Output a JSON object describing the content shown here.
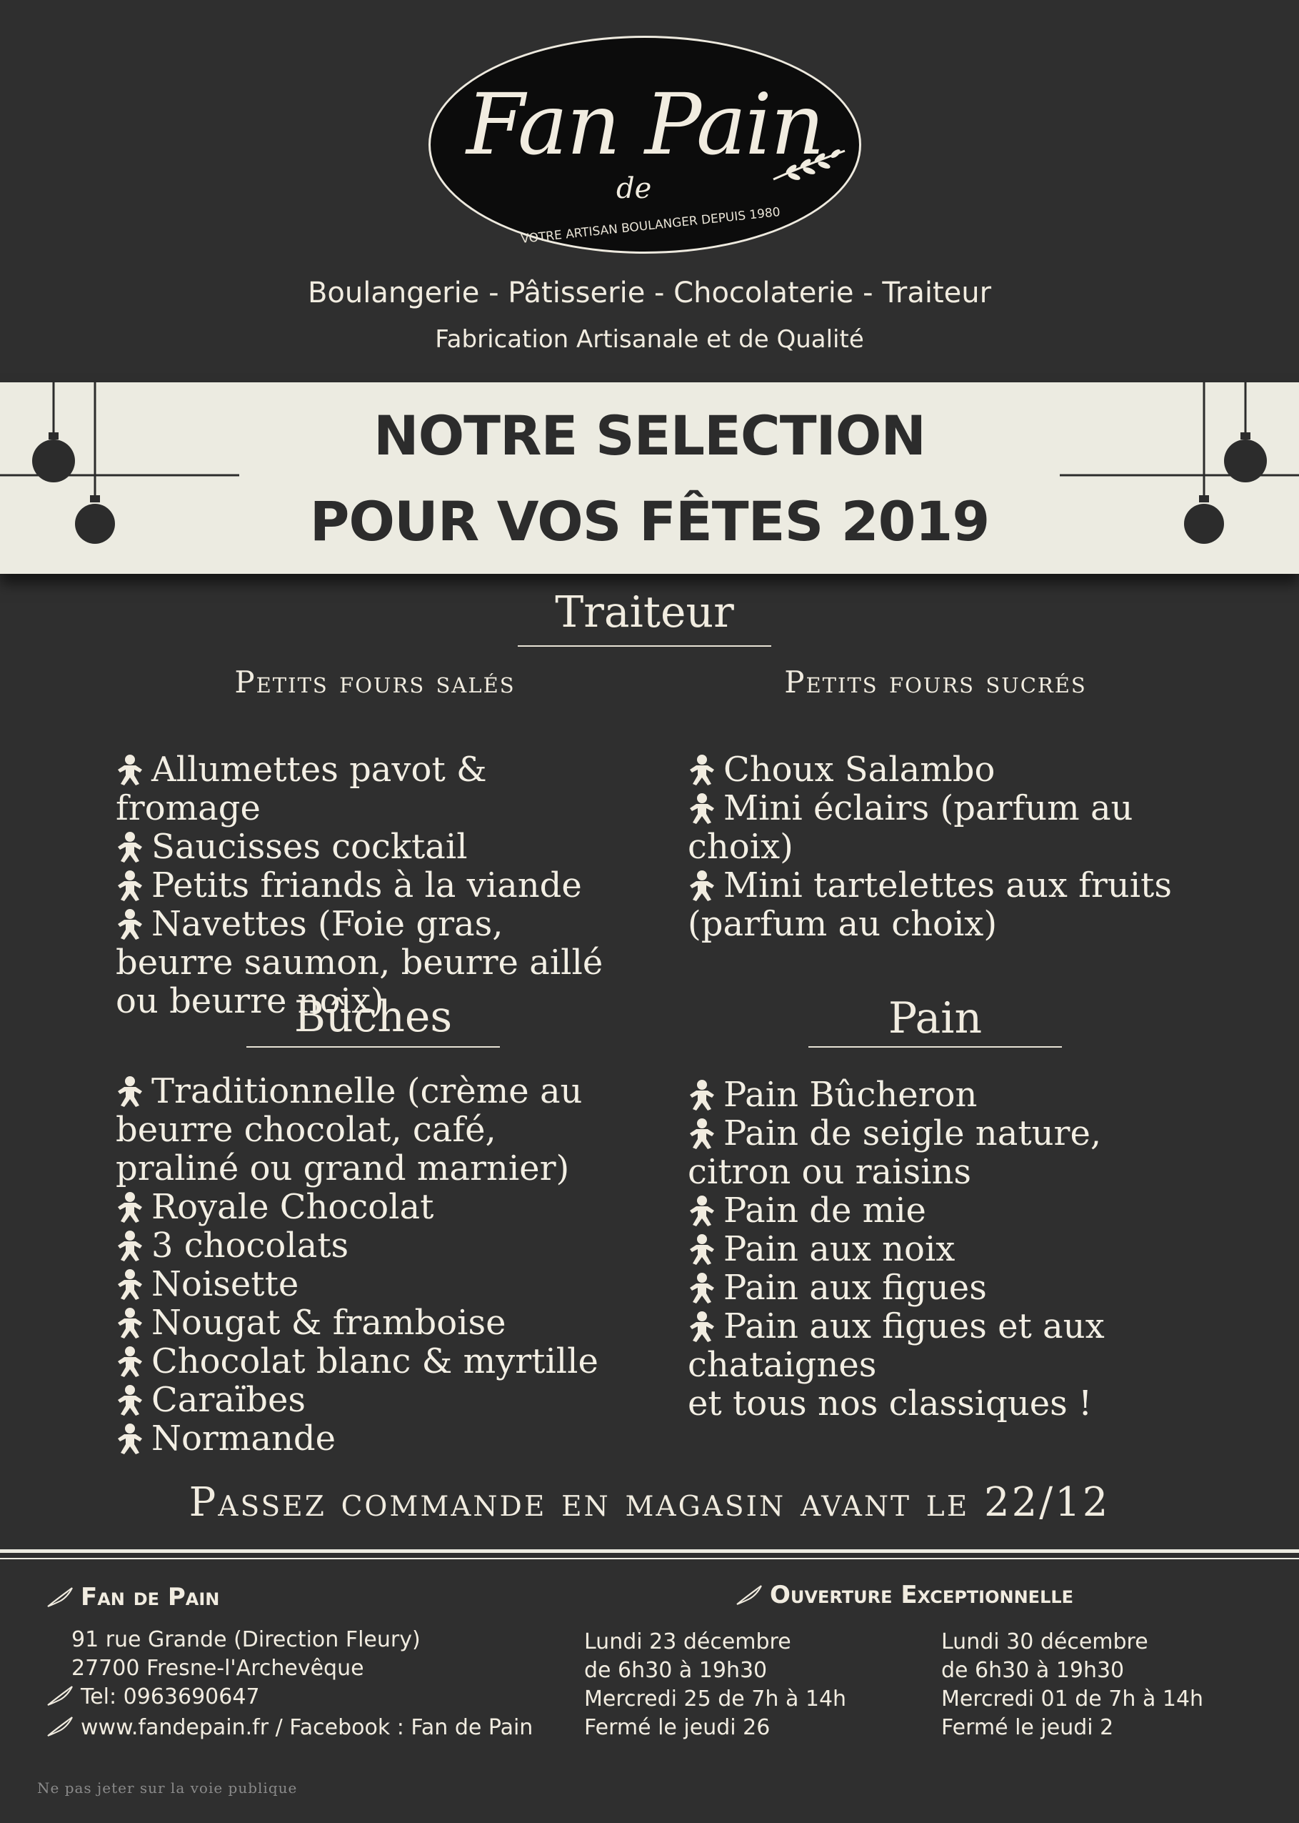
{
  "brand": {
    "logo_name": "Fan de Pain",
    "logo_tagline": "VOTRE ARTISAN BOULANGER DEPUIS 1980",
    "services": "Boulangerie - Pâtisserie - Chocolaterie - Traiteur",
    "quality": "Fabrication Artisanale et de Qualité"
  },
  "banner": {
    "line1": "NOTRE SELECTION",
    "line2": "POUR VOS FÊTES 2019"
  },
  "traiteur": {
    "title": "Traiteur",
    "sales_title": "Petits fours salés",
    "sucres_title": "Petits fours sucrés",
    "sales_items": [
      "Allumettes pavot & fromage",
      "Saucisses cocktail",
      "Petits friands à la viande",
      "Navettes (Foie gras, beurre saumon, beurre aillé ou beurre noix)"
    ],
    "sucres_items": [
      "Choux Salambo",
      "Mini éclairs (parfum au choix)",
      "Mini tartelettes aux fruits (parfum au choix)"
    ]
  },
  "buches": {
    "title": "Bûches",
    "items": [
      "Traditionnelle (crème au beurre chocolat, café, praliné ou grand marnier)",
      "Royale Chocolat",
      "3 chocolats",
      "Noisette",
      "Nougat & framboise",
      "Chocolat blanc & myrtille",
      "Caraïbes",
      "Normande"
    ]
  },
  "pain": {
    "title": "Pain",
    "items": [
      "Pain Bûcheron",
      "Pain de seigle nature, citron ou raisins",
      "Pain de mie",
      "Pain aux noix",
      "Pain aux figues",
      "Pain aux figues et aux chataignes"
    ],
    "closing": "et tous nos classiques !"
  },
  "cta": "Passez commande en magasin avant le 22/12",
  "footer": {
    "shop_title": "Fan de Pain",
    "address1": "91 rue Grande (Direction Fleury)",
    "address2": "27700 Fresne-l'Archevêque",
    "phone": "Tel: 0963690647",
    "web": "www.fandepain.fr / Facebook : Fan de Pain",
    "opening_title": "Ouverture Exceptionnelle",
    "week1": [
      "Lundi 23 décembre",
      "de 6h30 à 19h30",
      "Mercredi 25 de 7h à 14h",
      "Fermé le jeudi 26"
    ],
    "week2": [
      "Lundi 30 décembre",
      "de 6h30 à 19h30",
      "Mercredi 01 de 7h à 14h",
      "Fermé le jeudi 2"
    ],
    "fine_print": "Ne pas jeter sur la voie publique"
  },
  "colors": {
    "background": "#2f2f2f",
    "banner": "#ecebe1",
    "text": "#f3efe4"
  }
}
